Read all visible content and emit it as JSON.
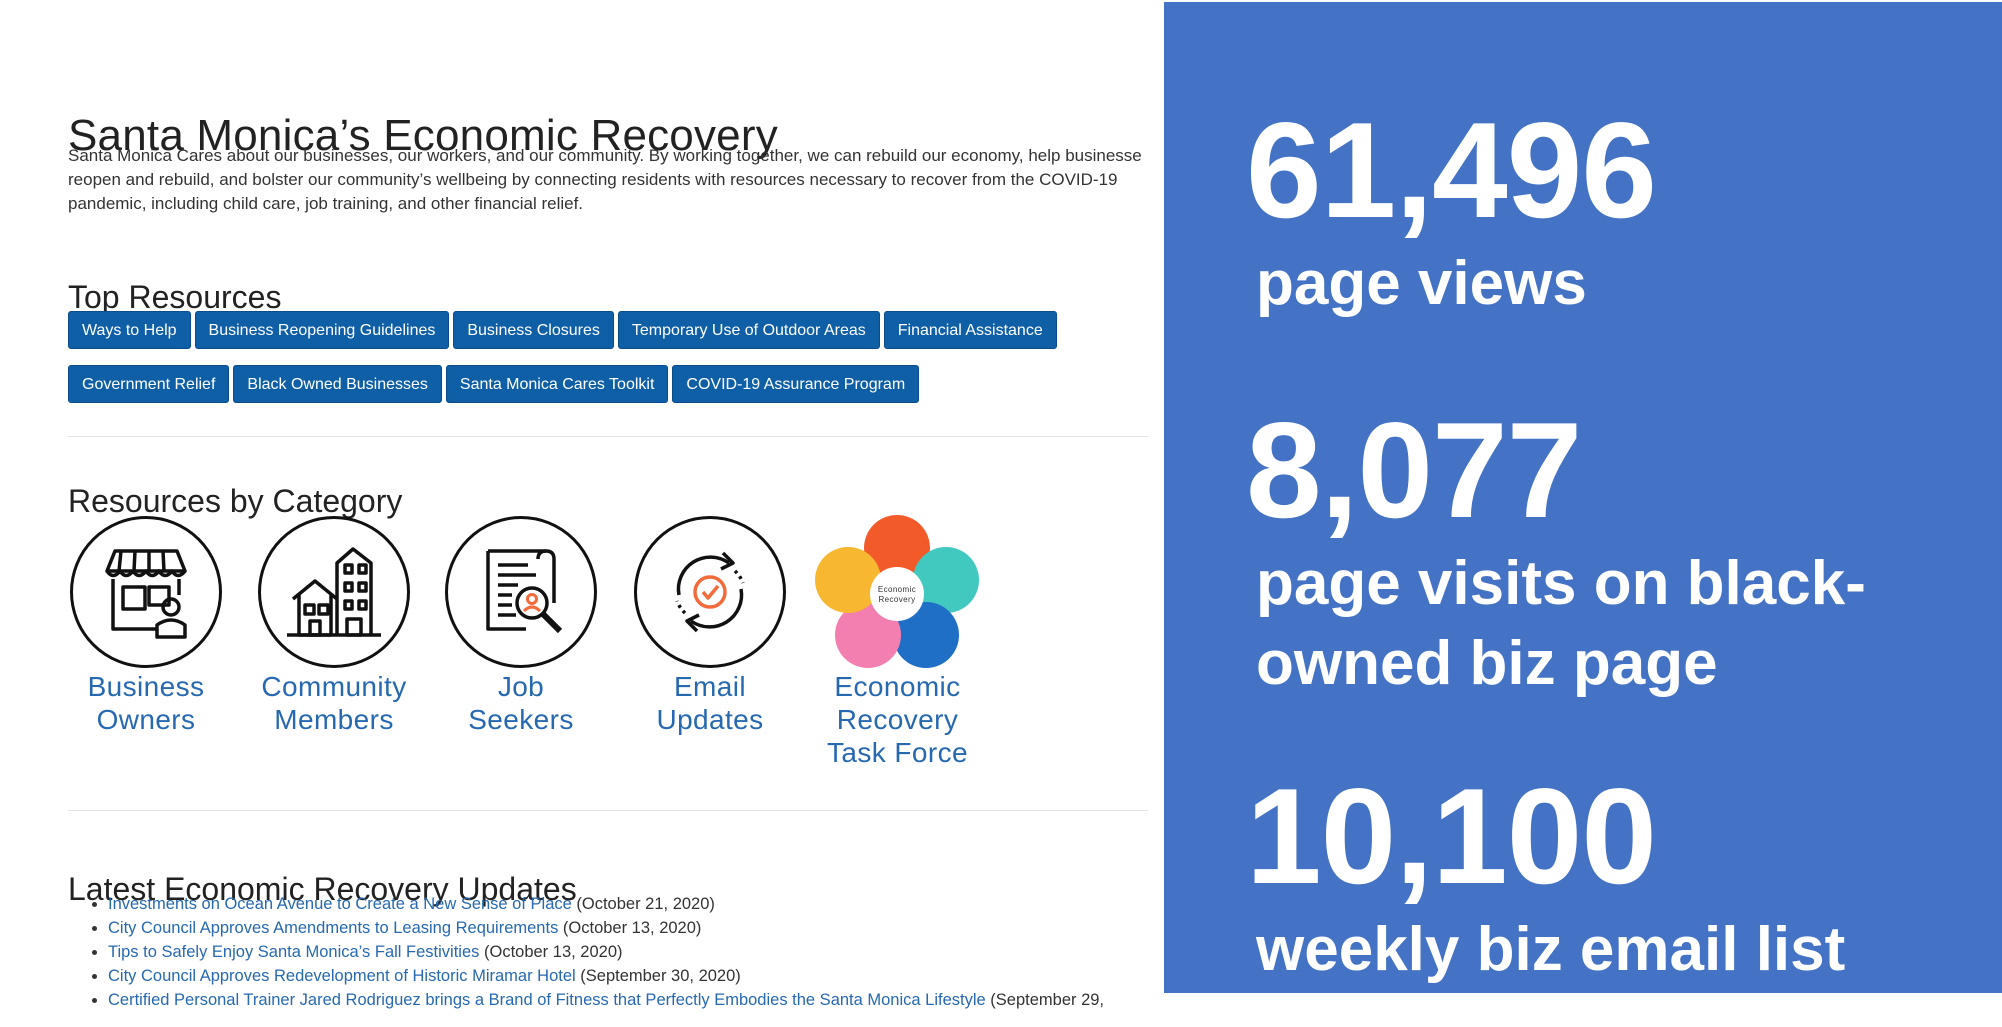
{
  "page": {
    "title": "Santa Monica’s Economic Recovery",
    "intro_lines": [
      "Santa Monica Cares about our businesses, our workers, and our community. By working together, we can rebuild our economy, help businesse",
      "reopen and rebuild, and bolster our community’s wellbeing by connecting residents with resources necessary to recover from the COVID-19",
      "pandemic, including child care, job training, and other financial relief."
    ]
  },
  "top_resources": {
    "heading": "Top Resources",
    "row1": [
      "Ways to Help",
      "Business Reopening Guidelines",
      "Business Closures",
      "Temporary Use of Outdoor Areas",
      "Financial Assistance"
    ],
    "row2": [
      "Government Relief",
      "Black Owned Businesses",
      "Santa Monica Cares Toolkit",
      "COVID-19 Assurance Program"
    ]
  },
  "categories": {
    "heading": "Resources by Category",
    "items": [
      {
        "label": "Business\nOwners",
        "icon": "storefront-icon"
      },
      {
        "label": "Community\nMembers",
        "icon": "buildings-icon"
      },
      {
        "label": "Job\nSeekers",
        "icon": "resume-search-icon"
      },
      {
        "label": "Email\nUpdates",
        "icon": "refresh-check-icon"
      },
      {
        "label": "Economic\nRecovery\nTask Force",
        "icon": "task-force-diagram-icon"
      }
    ],
    "task_force_diagram": {
      "center": "Economic Recovery",
      "colors": [
        "#f25a2a",
        "#41c9c0",
        "#1f6fc6",
        "#f27fb0",
        "#f7b731"
      ]
    }
  },
  "updates": {
    "heading": "Latest Economic Recovery Updates",
    "items": [
      {
        "link": "Investments on Ocean Avenue to Create a New Sense of Place",
        "date": " (October 21, 2020)"
      },
      {
        "link": "City Council Approves Amendments to Leasing Requirements",
        "date": " (October 13, 2020)"
      },
      {
        "link": "Tips to Safely Enjoy Santa Monica’s Fall Festivities",
        "date": " (October 13, 2020)"
      },
      {
        "link": "City Council Approves Redevelopment of Historic Miramar Hotel",
        "date": " (September 30, 2020)"
      },
      {
        "link": "Certified Personal Trainer Jared Rodriguez brings a Brand of Fitness that Perfectly Embodies the Santa Monica Lifestyle",
        "date": " (September 29,"
      }
    ]
  },
  "stats": {
    "background": "#4472c4",
    "items": [
      {
        "number": "61,496",
        "label_lines": [
          "page views"
        ]
      },
      {
        "number": "8,077",
        "label_lines": [
          "page visits on black-",
          "owned biz page"
        ]
      },
      {
        "number": "10,100",
        "label_lines": [
          "weekly biz email list"
        ]
      }
    ]
  }
}
